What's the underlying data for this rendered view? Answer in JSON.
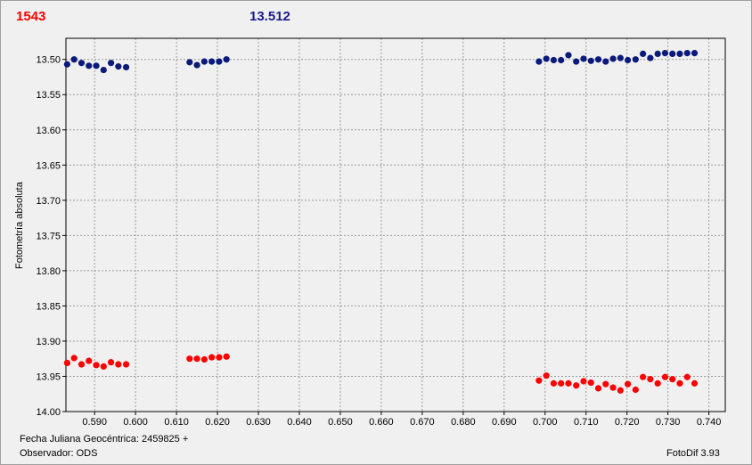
{
  "header": {
    "star_id": "1543",
    "magnitude": "13.512",
    "id_color": "#ff0000",
    "mag_color": "#1a1a8c"
  },
  "footer": {
    "jd_label": "Fecha Juliana Geocéntrica: 2459825 +",
    "observer_label": "Observador: ODS",
    "software": "FotoDif 3.93"
  },
  "chart_data": {
    "type": "scatter",
    "title": "",
    "xlabel": "",
    "ylabel": "Fotometría absoluta",
    "xlim": [
      0.583,
      0.744
    ],
    "ylim": [
      13.47,
      14.0
    ],
    "y_inverted": true,
    "grid": true,
    "x_ticks": [
      0.59,
      0.6,
      0.61,
      0.62,
      0.63,
      0.64,
      0.65,
      0.66,
      0.67,
      0.68,
      0.69,
      0.7,
      0.71,
      0.72,
      0.73,
      0.74
    ],
    "x_tick_labels": [
      "0.590",
      "0.600",
      "0.610",
      "0.620",
      "0.630",
      "0.640",
      "0.650",
      "0.660",
      "0.670",
      "0.680",
      "0.690",
      "0.700",
      "0.710",
      "0.720",
      "0.730",
      "0.740"
    ],
    "y_ticks": [
      13.5,
      13.55,
      13.6,
      13.65,
      13.7,
      13.75,
      13.8,
      13.85,
      13.9,
      13.95,
      14.0
    ],
    "y_tick_labels": [
      "13.50",
      "13.55",
      "13.60",
      "13.65",
      "13.70",
      "13.75",
      "13.80",
      "13.85",
      "13.90",
      "13.95",
      "14.00"
    ],
    "series": [
      {
        "color": "#0a1a7a",
        "x": [
          0.5833,
          0.585,
          0.5868,
          0.5886,
          0.5904,
          0.5922,
          0.594,
          0.5958,
          0.5977,
          0.6132,
          0.615,
          0.6168,
          0.6186,
          0.6204,
          0.6222,
          0.6985,
          0.7003,
          0.7021,
          0.7039,
          0.7057,
          0.7076,
          0.7094,
          0.7112,
          0.713,
          0.7148,
          0.7166,
          0.7184,
          0.7202,
          0.7221,
          0.7239,
          0.7257,
          0.7275,
          0.7293,
          0.7311,
          0.7329,
          0.7347,
          0.7365
        ],
        "y": [
          13.507,
          13.5,
          13.505,
          13.509,
          13.509,
          13.515,
          13.505,
          13.51,
          13.511,
          13.504,
          13.508,
          13.503,
          13.503,
          13.503,
          13.5,
          13.503,
          13.499,
          13.501,
          13.501,
          13.494,
          13.503,
          13.499,
          13.502,
          13.5,
          13.503,
          13.499,
          13.498,
          13.501,
          13.5,
          13.492,
          13.498,
          13.492,
          13.491,
          13.492,
          13.492,
          13.491,
          13.491
        ]
      },
      {
        "color": "#ff0000",
        "x": [
          0.5833,
          0.585,
          0.5868,
          0.5886,
          0.5904,
          0.5922,
          0.594,
          0.5958,
          0.5977,
          0.6132,
          0.615,
          0.6168,
          0.6186,
          0.6204,
          0.6222,
          0.6985,
          0.7003,
          0.7021,
          0.7039,
          0.7057,
          0.7076,
          0.7094,
          0.7112,
          0.713,
          0.7148,
          0.7166,
          0.7184,
          0.7202,
          0.7221,
          0.7239,
          0.7257,
          0.7275,
          0.7293,
          0.7311,
          0.7329,
          0.7347,
          0.7365
        ],
        "y": [
          13.931,
          13.924,
          13.933,
          13.928,
          13.934,
          13.936,
          13.93,
          13.933,
          13.933,
          13.925,
          13.925,
          13.926,
          13.923,
          13.923,
          13.922,
          13.956,
          13.949,
          13.96,
          13.96,
          13.96,
          13.963,
          13.957,
          13.959,
          13.967,
          13.961,
          13.966,
          13.97,
          13.961,
          13.969,
          13.951,
          13.954,
          13.96,
          13.951,
          13.954,
          13.96,
          13.951,
          13.96
        ]
      }
    ]
  }
}
